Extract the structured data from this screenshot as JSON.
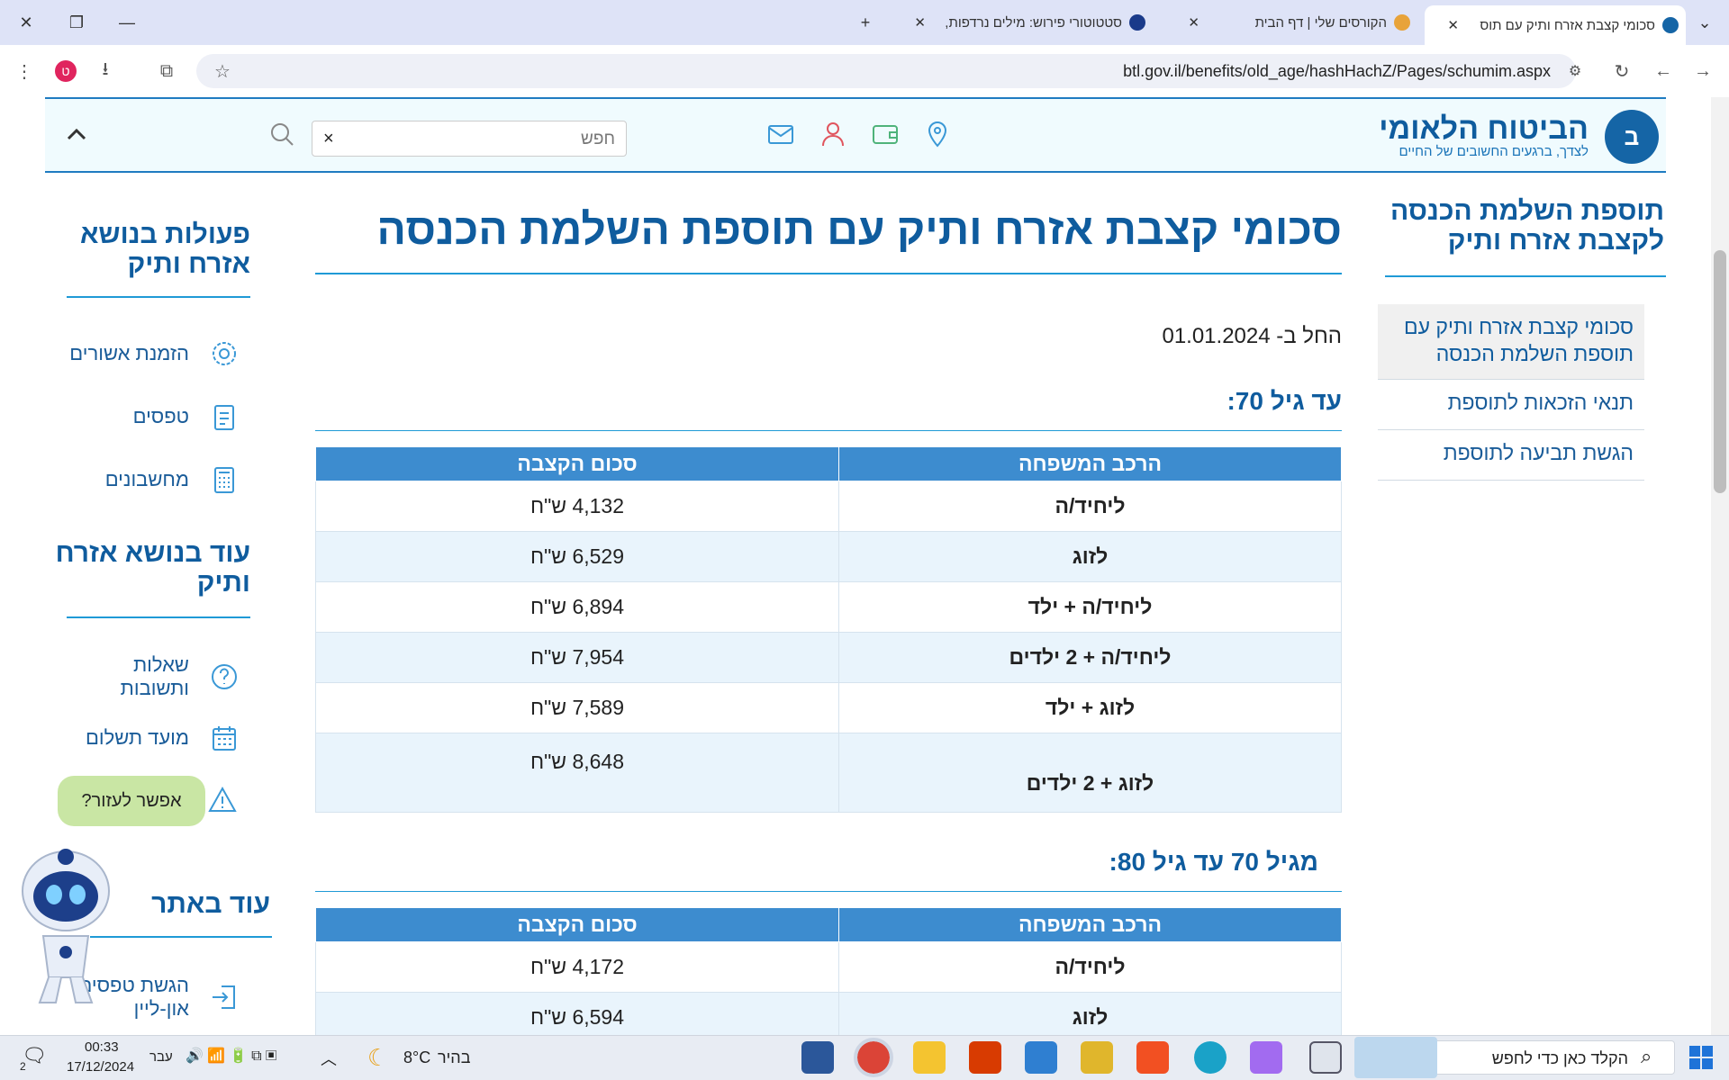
{
  "browser": {
    "tabs": [
      {
        "title": "סכומי קצבת אזרח ותיק עם תוס",
        "active": true
      },
      {
        "title": "הקורסים שלי | דף הבית",
        "active": false
      },
      {
        "title": "סטטוטורי פירוש: מילים נרדפות,",
        "active": false
      }
    ],
    "url": "btl.gov.il/benefits/old_age/hashHachZ/Pages/schumim.aspx",
    "profile_letter": "ט"
  },
  "site": {
    "logo_title": "הביטוח הלאומי",
    "logo_tagline": "לצדך, ברגעים החשובים של החיים",
    "search_placeholder": "חפש",
    "search_clear": "×"
  },
  "right_nav": {
    "heading": "תוספת השלמת הכנסה לקצבת אזרח ותיק",
    "items": [
      {
        "label": "סכומי קצבת אזרח ותיק עם תוספת השלמת הכנסה",
        "current": true
      },
      {
        "label": "תנאי הזכאות לתוספת",
        "current": false
      },
      {
        "label": "הגשת תביעה לתוספת",
        "current": false
      }
    ]
  },
  "main": {
    "title": "סכומי קצבת אזרח ותיק עם תוספת השלמת הכנסה",
    "effective_date": "החל ב- 01.01.2024",
    "col_family": "הרכב המשפחה",
    "col_amount": "סכום הקצבה",
    "sections": [
      {
        "heading": "עד גיל 70:",
        "rows": [
          {
            "family": "ליחיד/ה",
            "amount": "4,132 ש\"ח"
          },
          {
            "family": "לזוג",
            "amount": "6,529 ש\"ח"
          },
          {
            "family": "ליחיד/ה + ילד",
            "amount": "6,894 ש\"ח"
          },
          {
            "family": "ליחיד/ה + 2 ילדים",
            "amount": "7,954 ש\"ח"
          },
          {
            "family": "לזוג + ילד",
            "amount": "7,589 ש\"ח"
          },
          {
            "family": "לזוג + 2 ילדים",
            "amount": "8,648 ש\"ח"
          }
        ]
      },
      {
        "heading": "מגיל 70 עד גיל 80:",
        "rows": [
          {
            "family": "ליחיד/ה",
            "amount": "4,172 ש\"ח"
          },
          {
            "family": "לזוג",
            "amount": "6,594 ש\"ח"
          }
        ]
      }
    ]
  },
  "left_sidebar": {
    "actions_heading": "פעולות בנושא אזרח ותיק",
    "actions": [
      {
        "label": "הזמנת אשורים",
        "icon": "gear-icon"
      },
      {
        "label": "טפסים",
        "icon": "clipboard-icon"
      },
      {
        "label": "מחשבונים",
        "icon": "calculator-icon"
      }
    ],
    "more_heading": "עוד בנושא אזרח ותיק",
    "more": [
      {
        "label": "שאלות ותשובות",
        "icon": "question-icon"
      },
      {
        "label": "מועד תשלום",
        "icon": "calendar-icon"
      }
    ],
    "site_heading": "עוד באתר",
    "site_items": [
      {
        "label": "הגשת טפסים און-ליין",
        "icon": "login-icon"
      }
    ]
  },
  "chatbot": {
    "bubble": "אפשר לעזור?"
  },
  "taskbar": {
    "search_placeholder": "הקלד כאן כדי לחפש",
    "weather_temp": "8°C",
    "weather_desc": "בהיר",
    "language": "עבר",
    "time": "00:33",
    "date": "17/12/2024",
    "notification_count": "2"
  }
}
